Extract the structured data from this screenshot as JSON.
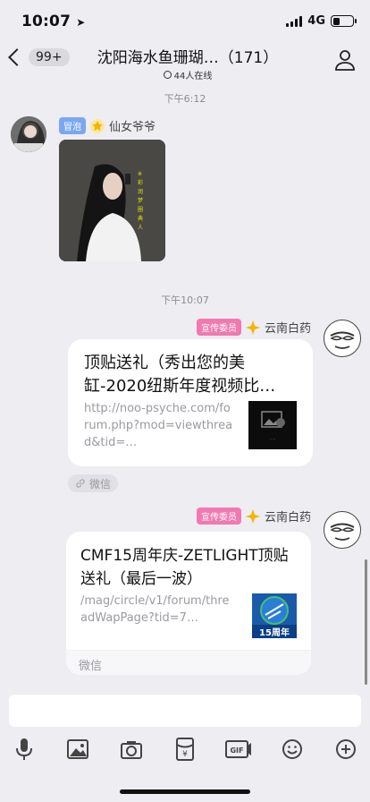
{
  "status": {
    "time": "10:07",
    "network": "4G"
  },
  "nav": {
    "unread": "99+",
    "title": "沈阳海水鱼珊瑚…（171）",
    "online": "44人在线"
  },
  "messages": {
    "time1": "下午6:12",
    "time2": "下午10:07",
    "m1": {
      "tag": "冒泡",
      "name": "仙女爷爷"
    },
    "m2": {
      "tag": "宣传委员",
      "name": "云南白药",
      "title": "顶贴送礼（秀出您的美缸-2020纽斯年度视频比…",
      "url": "http://noo-psyche.com/forum.php?mod=viewthread&tid=…",
      "source": "微信"
    },
    "m3": {
      "tag": "宣传委员",
      "name": "云南白药",
      "title": "CMF15周年庆-ZETLIGHT顶贴送礼（最后一波）",
      "url": "/mag/circle/v1/forum/threadWapPage?tid=7…",
      "source": "微信",
      "thumb_text": "15周年"
    }
  },
  "input": {
    "placeholder": ""
  },
  "colors": {
    "tag_pink": "#f07ab0",
    "tag_blue": "#7aa8f0",
    "background": "#ededf2"
  }
}
